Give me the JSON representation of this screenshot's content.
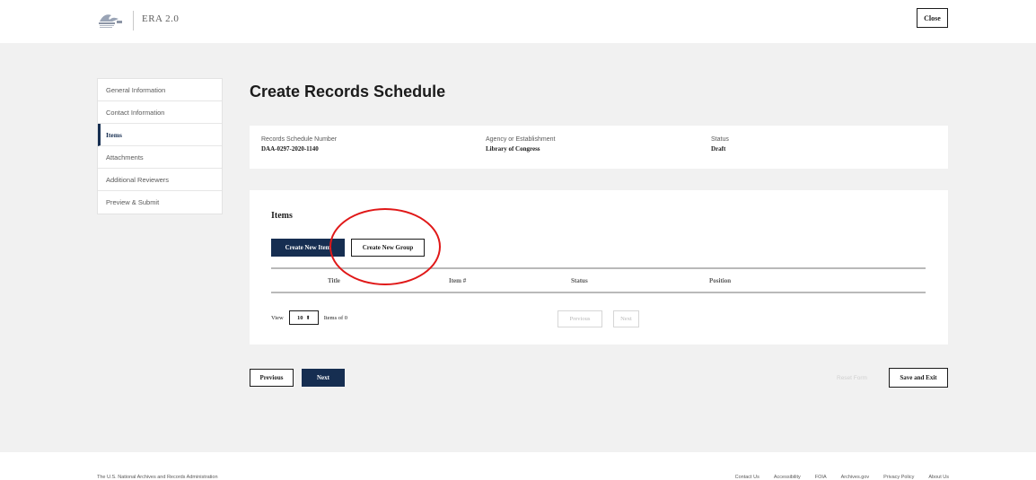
{
  "header": {
    "app_title": "ERA 2.0",
    "close_label": "Close"
  },
  "sidebar": {
    "items": [
      {
        "label": "General Information"
      },
      {
        "label": "Contact Information"
      },
      {
        "label": "Items",
        "active": true
      },
      {
        "label": "Attachments"
      },
      {
        "label": "Additional Reviewers"
      },
      {
        "label": "Preview & Submit"
      }
    ]
  },
  "main": {
    "title": "Create Records Schedule",
    "summary": {
      "schedule_number_label": "Records Schedule Number",
      "schedule_number_value": "DAA-0297-2020-1140",
      "agency_label": "Agency or Establishment",
      "agency_value": "Library of Congress",
      "status_label": "Status",
      "status_value": "Draft"
    },
    "items_section": {
      "heading": "Items",
      "create_item_label": "Create New Item",
      "create_group_label": "Create New Group",
      "columns": [
        "Title",
        "Item #",
        "Status",
        "Position"
      ],
      "view_label": "View",
      "view_value": "10",
      "items_of_label": "Items of 0",
      "prev_label": "Previous",
      "next_label": "Next"
    },
    "nav": {
      "previous_label": "Previous",
      "next_label": "Next",
      "reset_label": "Reset Form",
      "save_exit_label": "Save and Exit"
    }
  },
  "footer": {
    "org": "The U.S. National Archives and Records Administration",
    "links": [
      "Contact Us",
      "Accessibility",
      "FOIA",
      "Archives.gov",
      "Privacy Policy",
      "About Us"
    ]
  },
  "colors": {
    "primary": "#162e51",
    "annotation": "#e01818"
  }
}
